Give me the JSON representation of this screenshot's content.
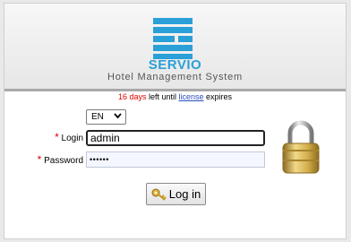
{
  "header": {
    "brand": "SERVIO",
    "subtitle": "Hotel Management System",
    "brand_color": "#2b9fd8",
    "logo_icon": "servio-logo-icon"
  },
  "license": {
    "days": "16 days",
    "text_before_link": " left until ",
    "link_label": "license",
    "text_after_link": " expires"
  },
  "language": {
    "selected": "EN",
    "arrow_icon": "chevron-down-icon"
  },
  "form": {
    "required_marker": "*",
    "login_label": "Login",
    "login_value": "admin",
    "password_label": "Password",
    "password_value": "••••••"
  },
  "lock_icon": "padlock-icon",
  "login_button": {
    "label": "Log in",
    "icon": "key-icon"
  }
}
